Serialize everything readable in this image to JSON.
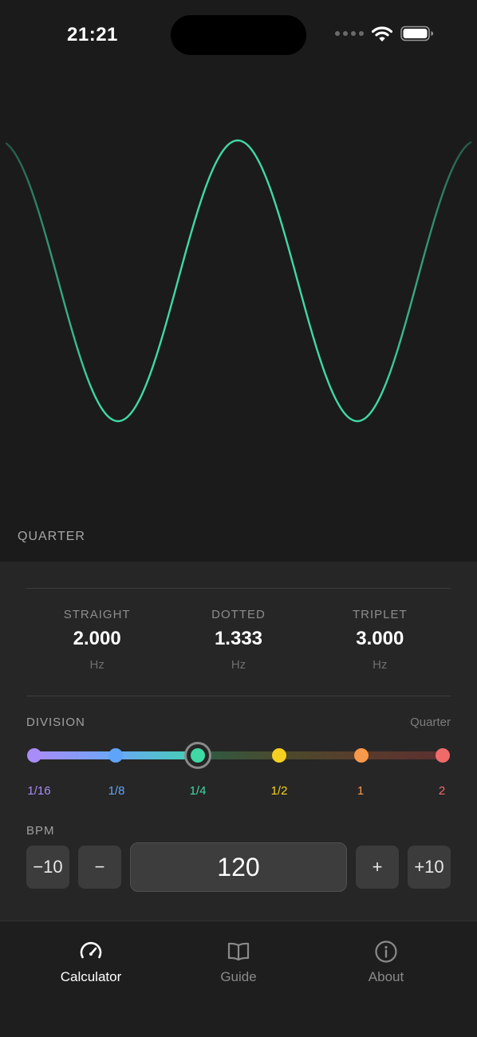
{
  "status_bar": {
    "time": "21:21"
  },
  "visualizer": {
    "division_caption": "QUARTER",
    "wave_color": "#3fd9a5"
  },
  "rates": [
    {
      "label": "STRAIGHT",
      "value": "2.000",
      "unit": "Hz"
    },
    {
      "label": "DOTTED",
      "value": "1.333",
      "unit": "Hz"
    },
    {
      "label": "TRIPLET",
      "value": "3.000",
      "unit": "Hz"
    }
  ],
  "division": {
    "label": "DIVISION",
    "current": "Quarter",
    "selected_index": 2,
    "stops": [
      {
        "label": "1/16",
        "color": "#a88cf7"
      },
      {
        "label": "1/8",
        "color": "#5fa4f8"
      },
      {
        "label": "1/4",
        "color": "#3fd9a5"
      },
      {
        "label": "1/2",
        "color": "#f5d020"
      },
      {
        "label": "1",
        "color": "#f7994a"
      },
      {
        "label": "2",
        "color": "#f06a6a"
      }
    ]
  },
  "bpm": {
    "label": "BPM",
    "value": "120",
    "minus10": "−10",
    "minus1": "−",
    "plus1": "+",
    "plus10": "+10"
  },
  "tabs": [
    {
      "label": "Calculator",
      "icon": "gauge-icon",
      "active": true
    },
    {
      "label": "Guide",
      "icon": "book-icon",
      "active": false
    },
    {
      "label": "About",
      "icon": "info-icon",
      "active": false
    }
  ]
}
